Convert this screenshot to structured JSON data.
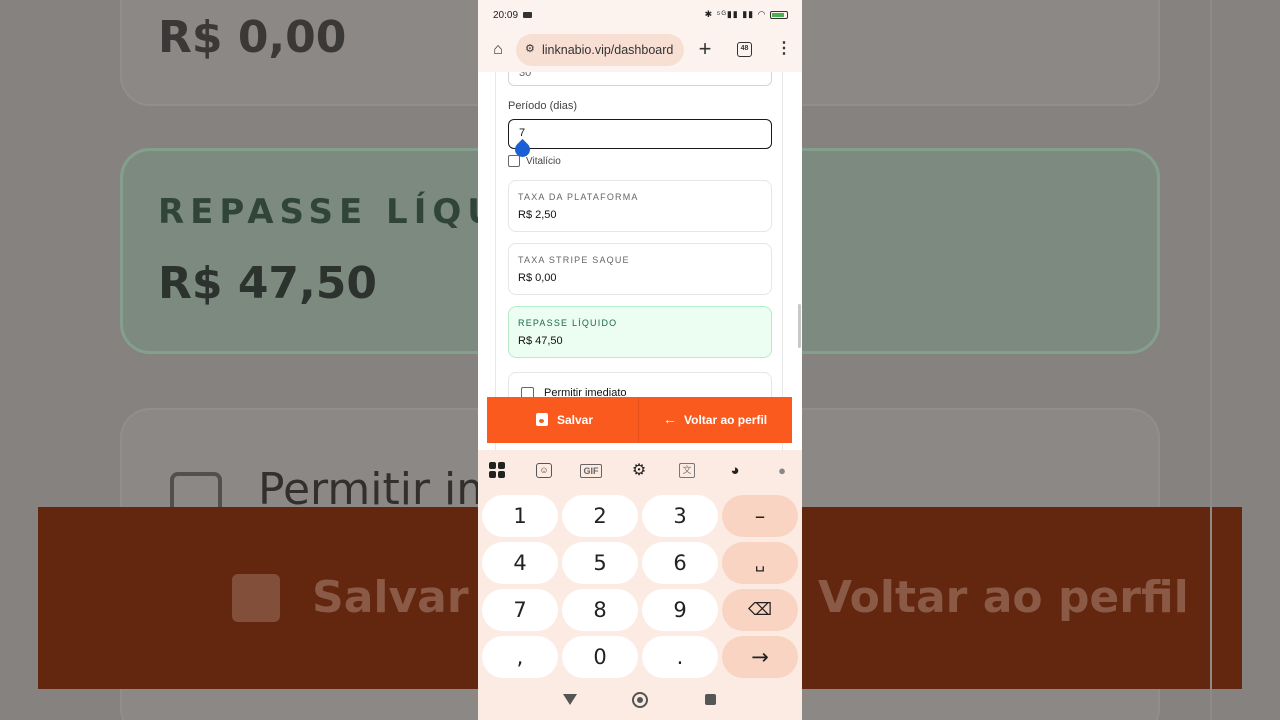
{
  "status": {
    "time": "20:09",
    "icons": "✱ ⁵ᴳ▮▮ ▮▮ ◠",
    "battery": "61"
  },
  "browser": {
    "url": "linknabio.vip/dashboard",
    "tab_count": "48"
  },
  "form": {
    "prev_value": "30",
    "periodo_label": "Período (dias)",
    "periodo_value": "7",
    "vitalicio_label": "Vitalício",
    "vitalicio_checked": false
  },
  "fees": [
    {
      "label": "TAXA DA PLATAFORMA",
      "value": "R$ 2,50"
    },
    {
      "label": "TAXA STRIPE SAQUE",
      "value": "R$ 0,00"
    },
    {
      "label": "REPASSE LÍQUIDO",
      "value": "R$ 47,50"
    }
  ],
  "permit": {
    "label": "Permitir imediato",
    "checked": false
  },
  "actions": {
    "save": "Salvar",
    "back": "Voltar ao perfil"
  },
  "keyboard": {
    "toolbar": [
      "apps-icon",
      "sticker-icon",
      "GIF",
      "gear-icon",
      "translate-icon",
      "palette-icon",
      "mic-icon"
    ],
    "gif": "GIF",
    "rows": [
      [
        "1",
        "2",
        "3",
        "–"
      ],
      [
        "4",
        "5",
        "6",
        "␣"
      ],
      [
        "7",
        "8",
        "9",
        "⌫"
      ],
      [
        ",",
        "0",
        ".",
        "→"
      ]
    ]
  },
  "backdrop": {
    "amount1": "R$ 0,00",
    "label2": "REPASSE LÍQUID",
    "amount2": "R$ 47,50",
    "permit": "Permitir im",
    "save": "Salvar",
    "back": "Voltar ao perfil"
  },
  "colors": {
    "accent": "#fa5a1e",
    "green_bg": "#ecfdf2",
    "keyboard_bg": "#fcebe2",
    "cursor": "#1a5fd6"
  }
}
